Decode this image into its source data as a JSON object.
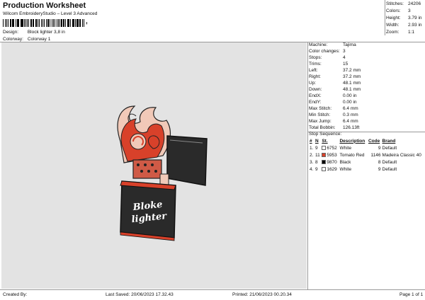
{
  "header": {
    "title": "Production Worksheet",
    "subtitle": "Wilcom EmbroideryStudio – Level 3 Advanced",
    "barcode_suffix": ","
  },
  "meta": {
    "design_label": "Design:",
    "design_value": "Block lighter 3,8 in",
    "colorway_label": "Colorway:",
    "colorway_value": "Colorway 1"
  },
  "stats": {
    "stitches_label": "Stitches:",
    "stitches": "24206",
    "colors_label": "Colors:",
    "colors": "3",
    "height_label": "Height:",
    "height": "3.79 in",
    "width_label": "Width:",
    "width": "2.93 in",
    "zoom_label": "Zoom:",
    "zoom": "1:1"
  },
  "machine_info": [
    {
      "label": "Machine:",
      "value": "Tajima"
    },
    {
      "label": "Color changes:",
      "value": "3"
    },
    {
      "label": "Stops:",
      "value": "4"
    },
    {
      "label": "Trims:",
      "value": "15"
    },
    {
      "label": "Left:",
      "value": "37.2 mm"
    },
    {
      "label": "Right:",
      "value": "37.2 mm"
    },
    {
      "label": "Up:",
      "value": "48.1 mm"
    },
    {
      "label": "Down:",
      "value": "48.1 mm"
    },
    {
      "label": "EndX:",
      "value": "0.00 in"
    },
    {
      "label": "EndY:",
      "value": "0.00 in"
    },
    {
      "label": "Max Stitch:",
      "value": "6.4 mm"
    },
    {
      "label": "Min Stitch:",
      "value": "0.3 mm"
    },
    {
      "label": "Max Jump:",
      "value": "6.4 mm"
    },
    {
      "label": "Total Bobbin:",
      "value": "126.13ft"
    }
  ],
  "stop_sequence": {
    "title": "Stop Sequence:",
    "columns": [
      "#",
      "N",
      "St.",
      "Description",
      "Code",
      "Brand"
    ],
    "rows": [
      {
        "index": "1.",
        "n": "9",
        "color": "#ffffff",
        "st": "6752",
        "description": "White",
        "code": "9",
        "brand": "Default"
      },
      {
        "index": "2.",
        "n": "11",
        "color": "#d8412a",
        "st": "5953",
        "description": "Tomato Red",
        "code": "1146",
        "brand": "Madeira Classic 40"
      },
      {
        "index": "3.",
        "n": "8",
        "color": "#000000",
        "st": "9870",
        "description": "Black",
        "code": "8",
        "brand": "Default"
      },
      {
        "index": "4.",
        "n": "9",
        "color": "#ffffff",
        "st": "1629",
        "description": "White",
        "code": "9",
        "brand": "Default"
      }
    ]
  },
  "design_text": {
    "line1": "Bloke",
    "line2": "lighter"
  },
  "footer": {
    "created_by": "Created By:",
    "last_saved": "Last Saved: 20/06/2023 17.32.43",
    "printed": "Printed: 21/06/2023 00.20.34",
    "page": "Page 1 of 1"
  },
  "colors": {
    "canvas_bg": "#e3e3e3",
    "lighter_body": "#2a2a2a",
    "flame_red": "#d8412a",
    "flame_light": "#f1c9b8"
  }
}
